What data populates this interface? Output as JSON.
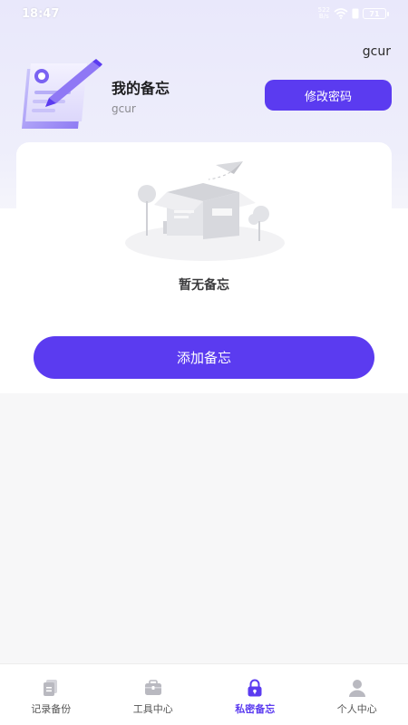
{
  "status_bar": {
    "time": "18:47",
    "net_speed_value": "522",
    "net_speed_unit": "B/s",
    "battery": "71"
  },
  "header": {
    "top_username": "gcur",
    "title": "我的备忘",
    "username": "gcur",
    "change_password_label": "修改密码"
  },
  "empty_state": {
    "text": "暂无备忘"
  },
  "actions": {
    "add_memo_label": "添加备忘"
  },
  "tab_bar": {
    "items": [
      {
        "label": "记录备份",
        "icon": "backup-icon",
        "active": false
      },
      {
        "label": "工具中心",
        "icon": "toolbox-icon",
        "active": false
      },
      {
        "label": "私密备忘",
        "icon": "lock-icon",
        "active": true
      },
      {
        "label": "个人中心",
        "icon": "person-icon",
        "active": false
      }
    ]
  },
  "colors": {
    "accent": "#5b3bf0",
    "inactive_icon": "#b9b9c0",
    "background": "#f7f7f8"
  }
}
